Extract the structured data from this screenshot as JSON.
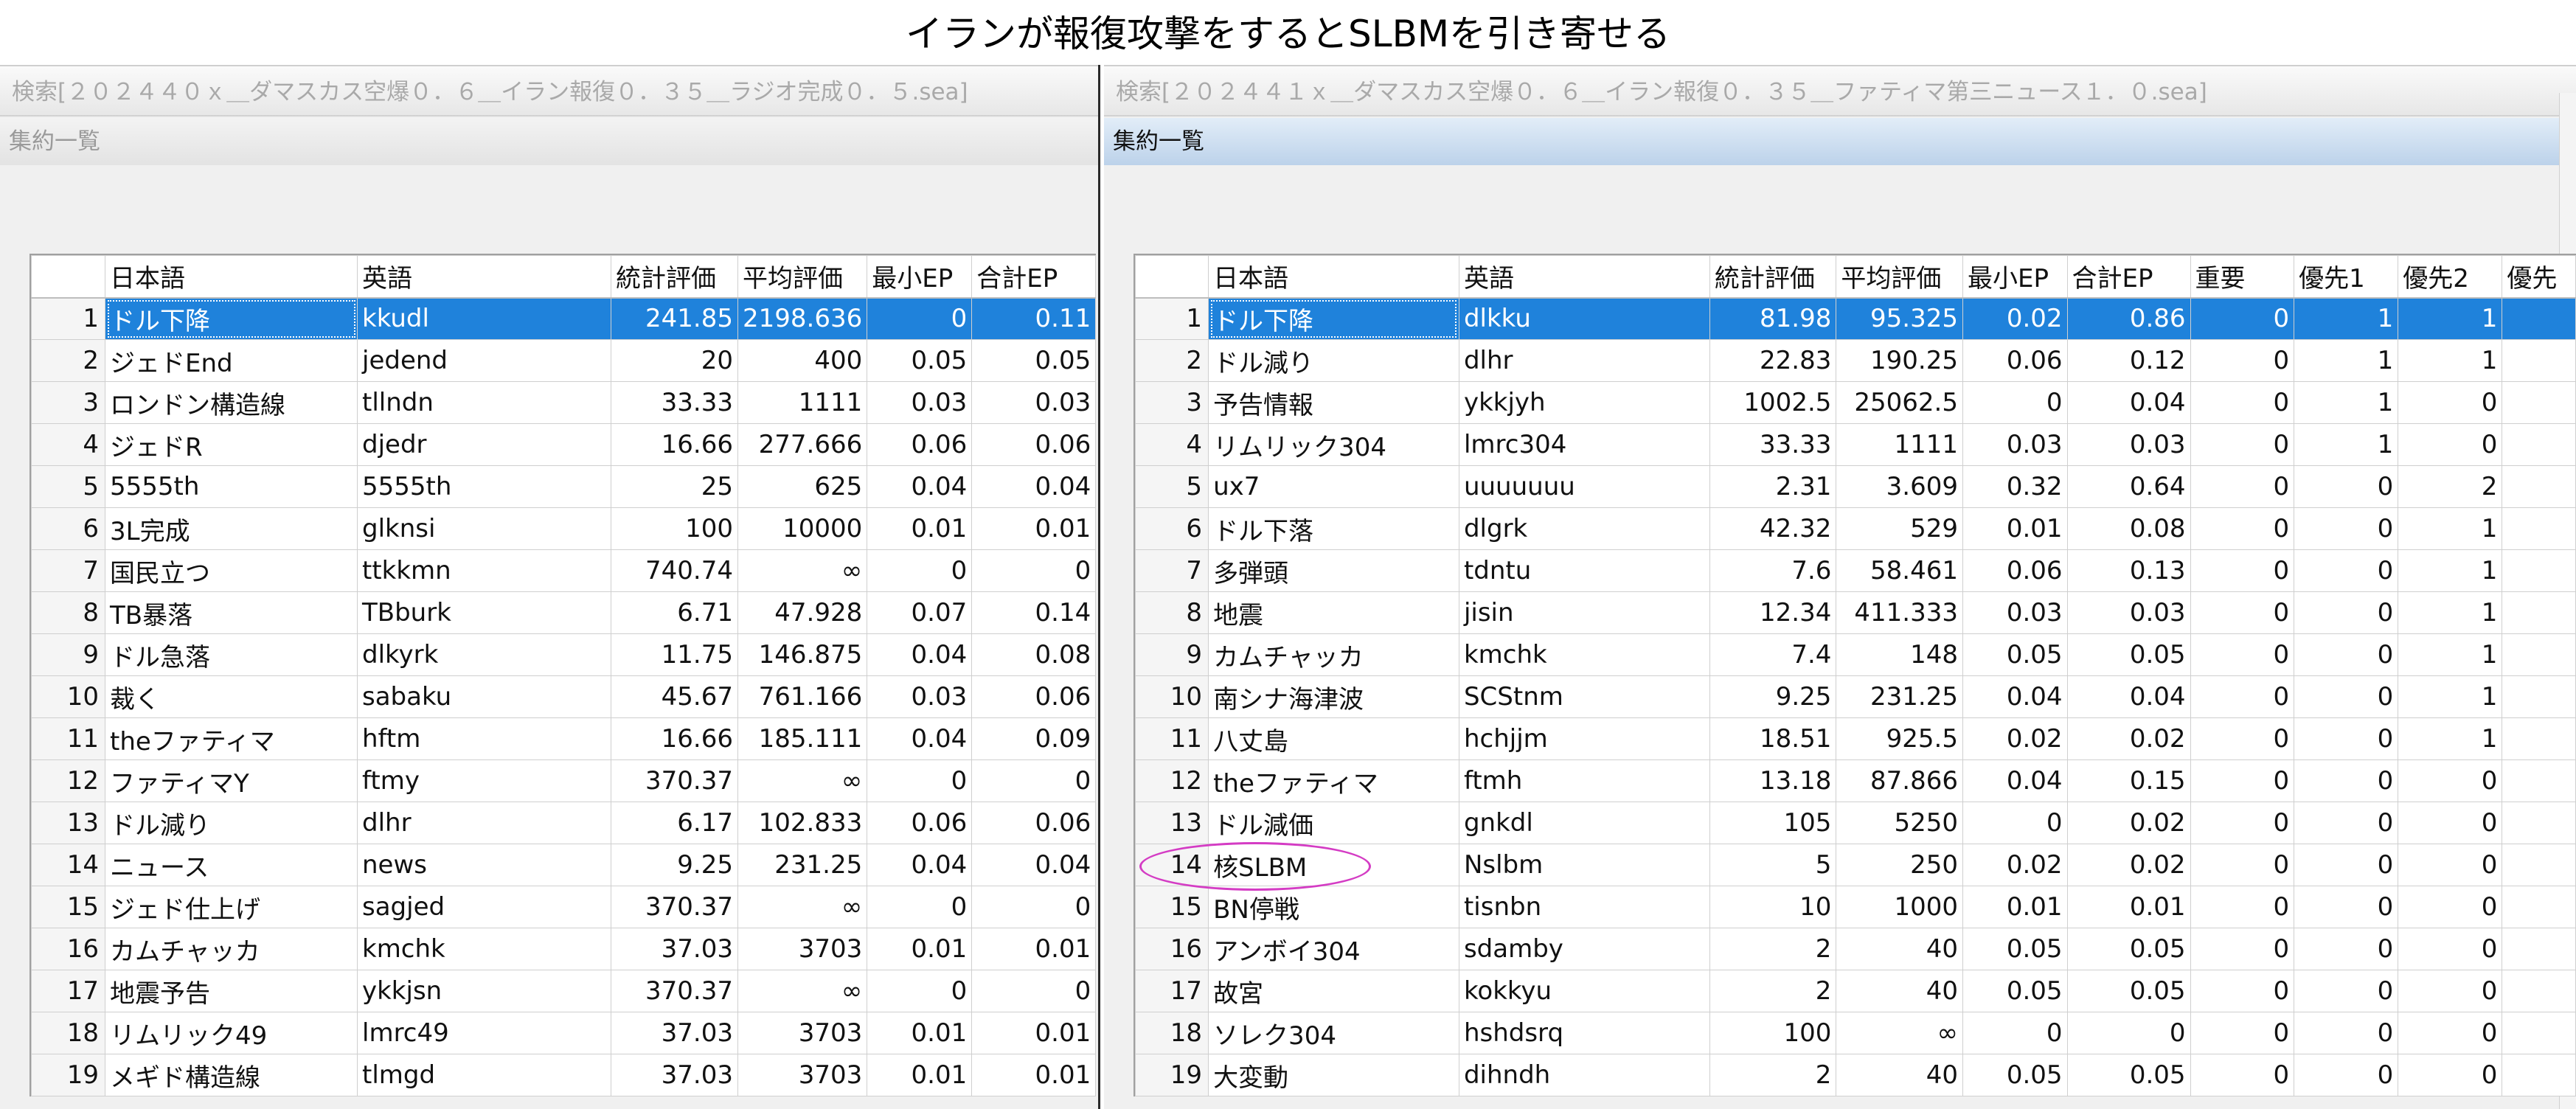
{
  "page_title": "イランが報復攻撃をするとSLBMを引き寄せる",
  "left": {
    "window_title": "検索[２０２４４０ｘ＿ダマスカス空爆０．６＿イラン報復０．３５＿ラジオ完成０．５.sea]",
    "summary_label": "集約一覧",
    "columns": [
      "",
      "日本語",
      "英語",
      "統計評価",
      "平均評価",
      "最小EP",
      "合計EP"
    ],
    "rows": [
      [
        "1",
        "ドル下降",
        "kkudl",
        "241.85",
        "2198.636",
        "0",
        "0.11"
      ],
      [
        "2",
        "ジェドEnd",
        "jedend",
        "20",
        "400",
        "0.05",
        "0.05"
      ],
      [
        "3",
        "ロンドン構造線",
        "tllndn",
        "33.33",
        "1111",
        "0.03",
        "0.03"
      ],
      [
        "4",
        "ジェドR",
        "djedr",
        "16.66",
        "277.666",
        "0.06",
        "0.06"
      ],
      [
        "5",
        "5555th",
        "5555th",
        "25",
        "625",
        "0.04",
        "0.04"
      ],
      [
        "6",
        "3L完成",
        "glknsi",
        "100",
        "10000",
        "0.01",
        "0.01"
      ],
      [
        "7",
        "国民立つ",
        "ttkkmn",
        "740.74",
        "∞",
        "0",
        "0"
      ],
      [
        "8",
        "TB暴落",
        "TBburk",
        "6.71",
        "47.928",
        "0.07",
        "0.14"
      ],
      [
        "9",
        "ドル急落",
        "dlkyrk",
        "11.75",
        "146.875",
        "0.04",
        "0.08"
      ],
      [
        "10",
        "裁く",
        "sabaku",
        "45.67",
        "761.166",
        "0.03",
        "0.06"
      ],
      [
        "11",
        "theファティマ",
        "hftm",
        "16.66",
        "185.111",
        "0.04",
        "0.09"
      ],
      [
        "12",
        "ファティマY",
        "ftmy",
        "370.37",
        "∞",
        "0",
        "0"
      ],
      [
        "13",
        "ドル減り",
        "dlhr",
        "6.17",
        "102.833",
        "0.06",
        "0.06"
      ],
      [
        "14",
        "ニュース",
        "news",
        "9.25",
        "231.25",
        "0.04",
        "0.04"
      ],
      [
        "15",
        "ジェド仕上げ",
        "sagjed",
        "370.37",
        "∞",
        "0",
        "0"
      ],
      [
        "16",
        "カムチャッカ",
        "kmchk",
        "37.03",
        "3703",
        "0.01",
        "0.01"
      ],
      [
        "17",
        "地震予告",
        "ykkjsn",
        "370.37",
        "∞",
        "0",
        "0"
      ],
      [
        "18",
        "リムリック49",
        "lmrc49",
        "37.03",
        "3703",
        "0.01",
        "0.01"
      ],
      [
        "19",
        "メギド構造線",
        "tlmgd",
        "37.03",
        "3703",
        "0.01",
        "0.01"
      ]
    ]
  },
  "right": {
    "window_title": "検索[２０２４４１ｘ＿ダマスカス空爆０．６＿イラン報復０．３５＿ファティマ第三ニュース１．０.sea]",
    "summary_label": "集約一覧",
    "columns": [
      "",
      "日本語",
      "英語",
      "統計評価",
      "平均評価",
      "最小EP",
      "合計EP",
      "重要",
      "優先1",
      "優先2",
      "優先"
    ],
    "rows": [
      [
        "1",
        "ドル下降",
        "dlkku",
        "81.98",
        "95.325",
        "0.02",
        "0.86",
        "0",
        "1",
        "1",
        ""
      ],
      [
        "2",
        "ドル減り",
        "dlhr",
        "22.83",
        "190.25",
        "0.06",
        "0.12",
        "0",
        "1",
        "1",
        ""
      ],
      [
        "3",
        "予告情報",
        "ykkjyh",
        "1002.5",
        "25062.5",
        "0",
        "0.04",
        "0",
        "1",
        "0",
        ""
      ],
      [
        "4",
        "リムリック304",
        "lmrc304",
        "33.33",
        "1111",
        "0.03",
        "0.03",
        "0",
        "1",
        "0",
        ""
      ],
      [
        "5",
        "ux7",
        "uuuuuuu",
        "2.31",
        "3.609",
        "0.32",
        "0.64",
        "0",
        "0",
        "2",
        ""
      ],
      [
        "6",
        "ドル下落",
        "dlgrk",
        "42.32",
        "529",
        "0.01",
        "0.08",
        "0",
        "0",
        "1",
        ""
      ],
      [
        "7",
        "多弾頭",
        "tdntu",
        "7.6",
        "58.461",
        "0.06",
        "0.13",
        "0",
        "0",
        "1",
        ""
      ],
      [
        "8",
        "地震",
        "jisin",
        "12.34",
        "411.333",
        "0.03",
        "0.03",
        "0",
        "0",
        "1",
        ""
      ],
      [
        "9",
        "カムチャッカ",
        "kmchk",
        "7.4",
        "148",
        "0.05",
        "0.05",
        "0",
        "0",
        "1",
        ""
      ],
      [
        "10",
        "南シナ海津波",
        "SCStnm",
        "9.25",
        "231.25",
        "0.04",
        "0.04",
        "0",
        "0",
        "1",
        ""
      ],
      [
        "11",
        "八丈島",
        "hchjjm",
        "18.51",
        "925.5",
        "0.02",
        "0.02",
        "0",
        "0",
        "1",
        ""
      ],
      [
        "12",
        "theファティマ",
        "ftmh",
        "13.18",
        "87.866",
        "0.04",
        "0.15",
        "0",
        "0",
        "0",
        ""
      ],
      [
        "13",
        "ドル減価",
        "gnkdl",
        "105",
        "5250",
        "0",
        "0.02",
        "0",
        "0",
        "0",
        ""
      ],
      [
        "14",
        "核SLBM",
        "Nslbm",
        "5",
        "250",
        "0.02",
        "0.02",
        "0",
        "0",
        "0",
        ""
      ],
      [
        "15",
        "BN停戦",
        "tisnbn",
        "10",
        "1000",
        "0.01",
        "0.01",
        "0",
        "0",
        "0",
        ""
      ],
      [
        "16",
        "アンボイ304",
        "sdamby",
        "2",
        "40",
        "0.05",
        "0.05",
        "0",
        "0",
        "0",
        ""
      ],
      [
        "17",
        "故宮",
        "kokkyu",
        "2",
        "40",
        "0.05",
        "0.05",
        "0",
        "0",
        "0",
        ""
      ],
      [
        "18",
        "ソレク304",
        "hshdsrq",
        "100",
        "∞",
        "0",
        "0",
        "0",
        "0",
        "0",
        ""
      ],
      [
        "19",
        "大変動",
        "dihndh",
        "2",
        "40",
        "0.05",
        "0.05",
        "0",
        "0",
        "0",
        ""
      ]
    ]
  }
}
